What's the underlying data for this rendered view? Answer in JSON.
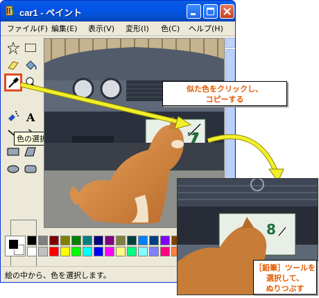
{
  "window": {
    "title": "car1 - ペイント"
  },
  "menu": [
    "ファイル(F)",
    "編集(E)",
    "表示(V)",
    "変形(I)",
    "色(C)",
    "ヘルプ(H)"
  ],
  "tools": [
    {
      "name": "free-select-tool",
      "selected": false
    },
    {
      "name": "rect-select-tool",
      "selected": false
    },
    {
      "name": "eraser-tool",
      "selected": false
    },
    {
      "name": "fill-tool",
      "selected": false
    },
    {
      "name": "color-picker-tool",
      "selected": true
    },
    {
      "name": "magnifier-tool",
      "selected": false
    },
    {
      "name": "pencil-tool",
      "selected": false
    },
    {
      "name": "brush-tool",
      "selected": false
    },
    {
      "name": "airbrush-tool",
      "selected": false
    },
    {
      "name": "text-tool",
      "selected": false
    },
    {
      "name": "line-tool",
      "selected": false
    },
    {
      "name": "curve-tool",
      "selected": false
    },
    {
      "name": "rectangle-tool",
      "selected": false
    },
    {
      "name": "polygon-tool",
      "selected": false
    },
    {
      "name": "ellipse-tool",
      "selected": false
    },
    {
      "name": "rounded-rect-tool",
      "selected": false
    }
  ],
  "tooltip": "色の選択",
  "palette": {
    "top": [
      "#000000",
      "#808080",
      "#800000",
      "#808000",
      "#008000",
      "#008080",
      "#000080",
      "#800080",
      "#808040",
      "#004040",
      "#0080ff",
      "#004080",
      "#8000ff",
      "#804000"
    ],
    "bottom": [
      "#ffffff",
      "#c0c0c0",
      "#ff0000",
      "#ffff00",
      "#00ff00",
      "#00ffff",
      "#0000ff",
      "#ff00ff",
      "#ffff80",
      "#00ff80",
      "#80ffff",
      "#8080ff",
      "#ff0080",
      "#ff8040"
    ]
  },
  "status": "絵の中から、色を選択します。",
  "callouts": {
    "pick_line1": "似た色をクリックし、",
    "pick_line2": "コピーする",
    "pencil_line1": "［鉛筆］ツールを選択して、",
    "pencil_line2": "ぬりつぶす"
  },
  "plate_text": "7",
  "zoom_plate_text": "8",
  "colors": {
    "title_bar": "#0353e9",
    "highlight": "#e04a22",
    "callout_text": "#e65a00",
    "arrow": "#f2ee2b"
  }
}
